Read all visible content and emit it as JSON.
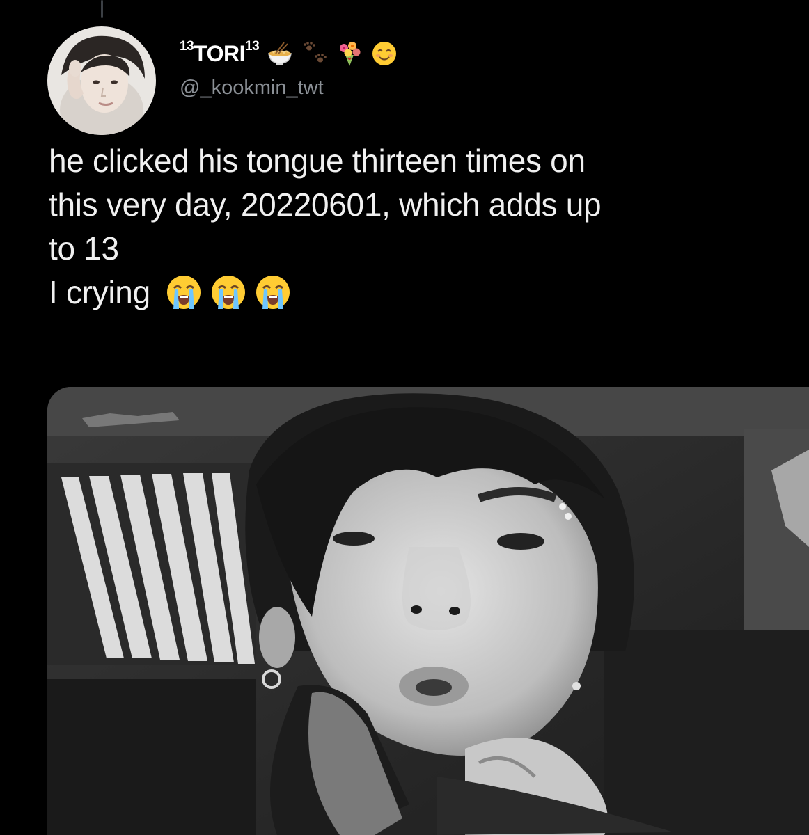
{
  "tweet": {
    "display_name": "TORI",
    "display_name_prefix_superscript": "13",
    "display_name_suffix_superscript": "13",
    "name_emojis": [
      "ramen-bowl-emoji",
      "paw-prints-emoji",
      "bouquet-emoji",
      "smiling-face-emoji"
    ],
    "handle": "@_kookmin_twt",
    "text_lines": [
      "he clicked his tongue thirteen times on",
      "this very day, 20220601, which adds up",
      "to 13",
      "I crying"
    ],
    "trailing_emojis": [
      "loudly-crying-face-emoji",
      "loudly-crying-face-emoji",
      "loudly-crying-face-emoji"
    ],
    "avatar": "profile-photo",
    "media": "black-and-white-selfie-photo"
  },
  "colors": {
    "background": "#000000",
    "text_primary": "#f0f0f0",
    "text_secondary": "#8b9096",
    "display_name": "#ffffff"
  }
}
